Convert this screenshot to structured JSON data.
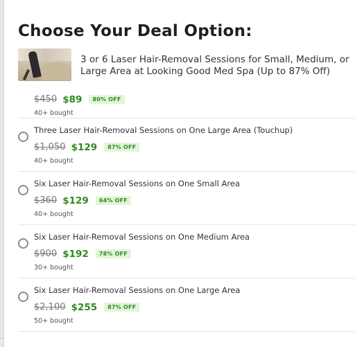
{
  "modal": {
    "title": "Choose Your Deal Option:",
    "deal_name": "3 or 6 Laser Hair-Removal Sessions for Small, Medium, or Large Area at Looking Good Med Spa (Up to 87% Off)"
  },
  "options": [
    {
      "title": "",
      "old_price": "$450",
      "new_price": "$89",
      "discount": "80% OFF",
      "bought": "40+ bought"
    },
    {
      "title": "Three Laser Hair-Removal Sessions on One Large Area (Touchup)",
      "old_price": "$1,050",
      "new_price": "$129",
      "discount": "87% OFF",
      "bought": "40+ bought"
    },
    {
      "title": "Six Laser Hair-Removal Sessions on One Small Area",
      "old_price": "$360",
      "new_price": "$129",
      "discount": "64% OFF",
      "bought": "40+ bought"
    },
    {
      "title": "Six Laser Hair-Removal Sessions on One Medium Area",
      "old_price": "$900",
      "new_price": "$192",
      "discount": "78% OFF",
      "bought": "30+ bought"
    },
    {
      "title": "Six Laser Hair-Removal Sessions on One Large Area",
      "old_price": "$2,100",
      "new_price": "$255",
      "discount": "87% OFF",
      "bought": "50+ bought"
    }
  ],
  "colors": {
    "price_green": "#2f8a1f",
    "badge_bg": "#e3f5d8",
    "separator": "#e6e6e6"
  }
}
